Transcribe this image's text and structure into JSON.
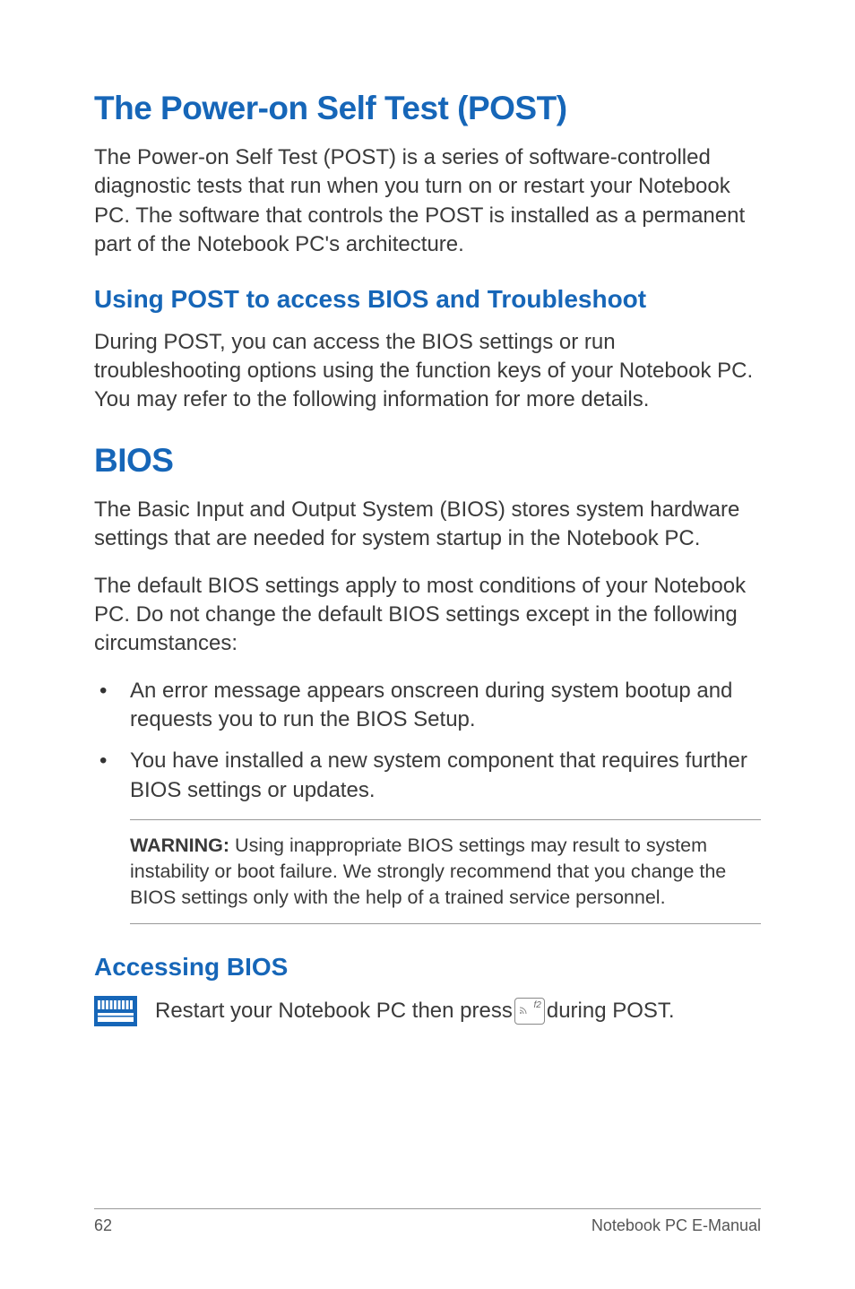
{
  "sections": {
    "post_title": "The Power-on Self Test (POST)",
    "post_intro": "The Power-on Self Test (POST)  is a series of software-controlled diagnostic tests that run when you turn on or restart your Notebook PC. The software that controls the POST is installed as a permanent part of the Notebook PC's architecture.",
    "using_post_title": "Using POST to access BIOS and Troubleshoot",
    "using_post_text": "During POST, you can access the BIOS settings or run troubleshooting options using the function keys of your Notebook PC. You may refer to the following information for more details.",
    "bios_title": "BIOS",
    "bios_intro1": "The Basic Input and Output System (BIOS) stores system hardware settings that are needed for system startup in the Notebook PC.",
    "bios_intro2": "The default BIOS settings apply to most conditions of your Notebook PC. Do not change the default BIOS settings except in the following circumstances:",
    "bullets": [
      "An error message appears onscreen during system bootup and requests you to run the BIOS Setup.",
      "You have installed a new system component that requires further BIOS settings or updates."
    ],
    "warning_label": "WARNING:",
    "warning_text": " Using inappropriate BIOS settings may result to system instability or boot failure. We strongly recommend that you change the BIOS settings only with the help of a trained service personnel.",
    "accessing_title": "Accessing BIOS",
    "accessing_pre": "Restart your Notebook PC then press ",
    "accessing_post": " during POST.",
    "key_label": "f2"
  },
  "footer": {
    "page_number": "62",
    "doc_title": "Notebook PC E-Manual"
  }
}
